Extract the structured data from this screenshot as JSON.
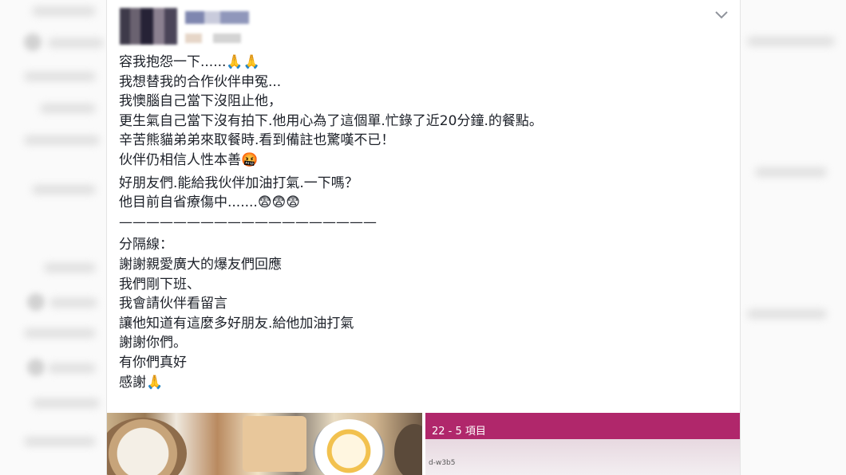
{
  "post": {
    "lines": [
      "容我抱怨一下......🙏🙏",
      "我想替我的合作伙伴申冤...",
      "我懊腦自己當下沒阻止他，",
      "更生氣自己當下沒有拍下.他用心為了這個單.忙錄了近20分鐘.的餐點。",
      "辛苦熊貓弟弟來取餐時.看到備註也驚嘆不已！",
      "伙伴仍相信人性本善🤬",
      "好朋友們.能給我伙伴加油打氣.一下嗎？",
      "他目前自省療傷中.......😨😨😨",
      "———————————————————",
      "分隔線：",
      "謝謝親愛廣大的爆友們回應",
      "我們剛下班、",
      "我會請伙伴看留言",
      "讓他知道有這麼多好朋友.給他加油打氣",
      "謝謝你們。",
      "有你們真好",
      "感謝🙏"
    ]
  },
  "photos": {
    "screen_text": "22 - 5 項目",
    "screen_sub": "d-w3b5"
  },
  "icons": {
    "options": "chevron-down-icon"
  },
  "colors": {
    "text": "#1d2129",
    "screen_magenta": "#b0276b"
  }
}
